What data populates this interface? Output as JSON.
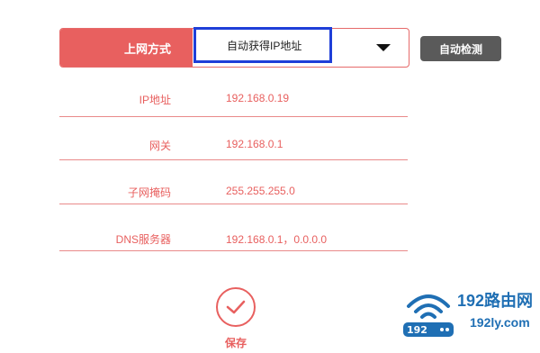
{
  "connection": {
    "label": "上网方式",
    "value": "自动获得IP地址"
  },
  "detect_button": "自动检测",
  "fields": [
    {
      "label": "IP地址",
      "value": "192.168.0.19"
    },
    {
      "label": "网关",
      "value": "192.168.0.1"
    },
    {
      "label": "子网掩码",
      "value": "255.255.255.0"
    },
    {
      "label": "DNS服务器",
      "value": "192.168.0.1，0.0.0.0"
    }
  ],
  "save_label": "保存",
  "watermark": {
    "title": "192路由网",
    "url": "192ly.com",
    "badge": "192"
  },
  "colors": {
    "accent": "#e8605f",
    "highlight_box": "#1f3fd8",
    "detect_button_bg": "#5a5a5a",
    "watermark": "#1f6fb4"
  }
}
